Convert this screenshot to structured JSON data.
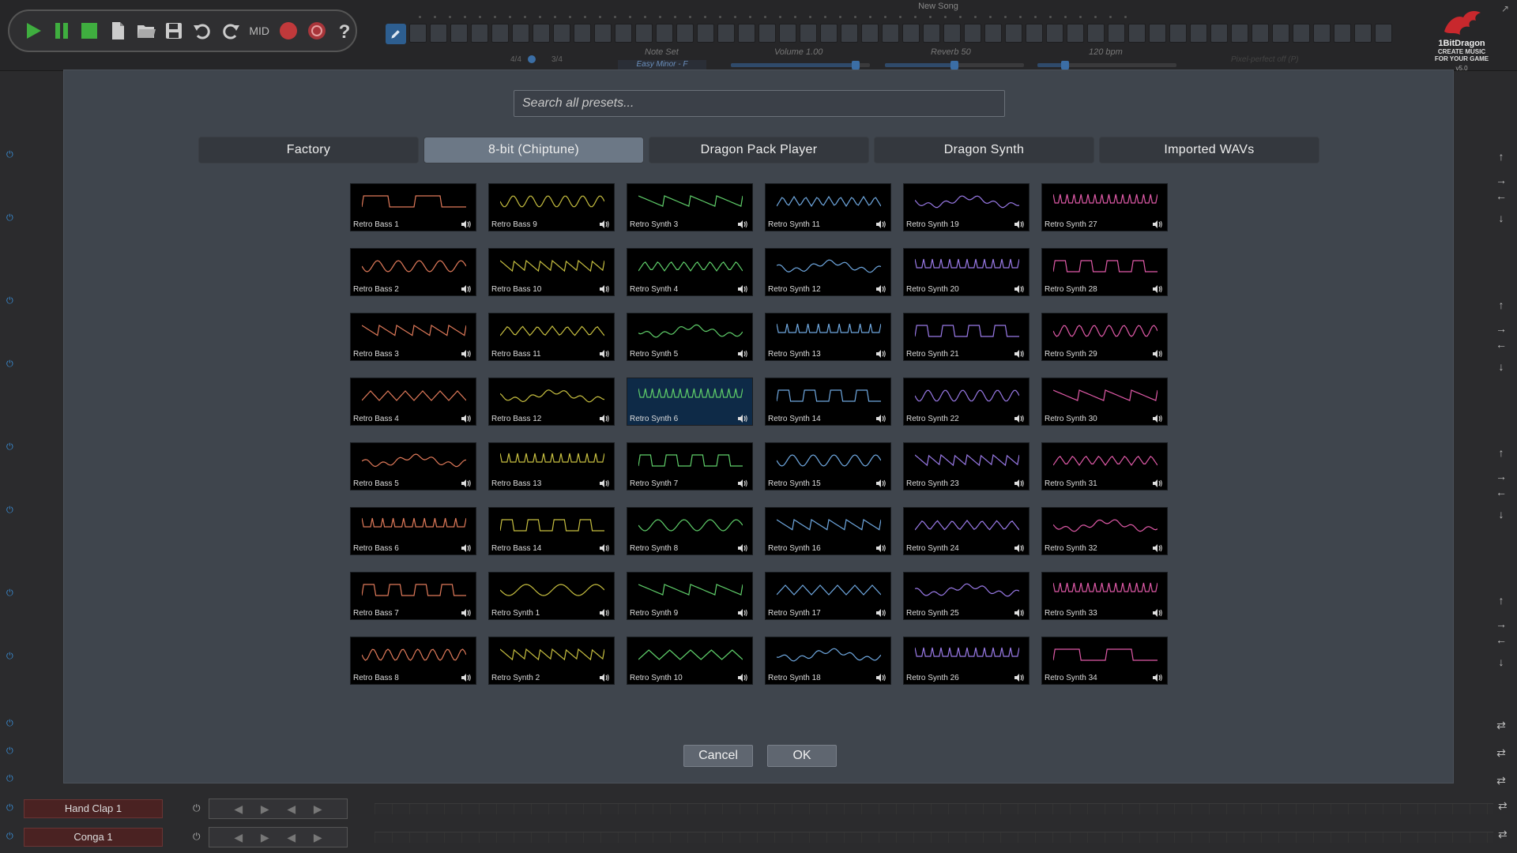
{
  "window": {
    "song_title": "New Song"
  },
  "transport": {
    "mid_label": "MID",
    "icons": [
      "play-icon",
      "pause-icon",
      "stop-icon",
      "new-file-icon",
      "open-folder-icon",
      "save-icon",
      "undo-icon",
      "redo-icon",
      "midi-icon",
      "record-icon",
      "loop-icon",
      "help-icon"
    ]
  },
  "toolbar": {
    "time_sig_1": "4/4",
    "time_sig_2": "3/4",
    "note_set_label": "Note Set",
    "note_set_value": "Easy Minor - F",
    "volume_label": "Volume 1.00",
    "volume_level": 0.9,
    "reverb_label": "Reverb 50",
    "reverb_level": 0.5,
    "tempo_label": "120 bpm",
    "tempo_level": 0.2,
    "pixel_perfect_label": "Pixel-perfect off (P)"
  },
  "logo": {
    "name": "1BitDragon",
    "tagline_1": "CREATE MUSIC",
    "tagline_2": "FOR YOUR GAME",
    "version": "v5.0"
  },
  "bottom_tracks": [
    {
      "name": "Hand Clap 1"
    },
    {
      "name": "Conga 1"
    }
  ],
  "dialog": {
    "search_placeholder": "Search all presets...",
    "tabs": [
      {
        "label": "Factory",
        "active": false
      },
      {
        "label": "8-bit (Chiptune)",
        "active": true
      },
      {
        "label": "Dragon Pack Player",
        "active": false
      },
      {
        "label": "Dragon Synth",
        "active": false
      },
      {
        "label": "Imported WAVs",
        "active": false
      }
    ],
    "columns": [
      {
        "color": "#e07a5a",
        "presets": [
          "Retro Bass 1",
          "Retro Bass 2",
          "Retro Bass 3",
          "Retro Bass 4",
          "Retro Bass 5",
          "Retro Bass 6",
          "Retro Bass 7",
          "Retro Bass 8"
        ]
      },
      {
        "color": "#c8c040",
        "presets": [
          "Retro Bass 9",
          "Retro Bass 10",
          "Retro Bass 11",
          "Retro Bass 12",
          "Retro Bass 13",
          "Retro Bass 14",
          "Retro Synth 1",
          "Retro Synth 2"
        ]
      },
      {
        "color": "#5fcf6a",
        "presets": [
          "Retro Synth 3",
          "Retro Synth 4",
          "Retro Synth 5",
          "Retro Synth 6",
          "Retro Synth 7",
          "Retro Synth 8",
          "Retro Synth 9",
          "Retro Synth 10"
        ]
      },
      {
        "color": "#6fa8e0",
        "presets": [
          "Retro Synth 11",
          "Retro Synth 12",
          "Retro Synth 13",
          "Retro Synth 14",
          "Retro Synth 15",
          "Retro Synth 16",
          "Retro Synth 17",
          "Retro Synth 18"
        ]
      },
      {
        "color": "#9a7ae8",
        "presets": [
          "Retro Synth 19",
          "Retro Synth 20",
          "Retro Synth 21",
          "Retro Synth 22",
          "Retro Synth 23",
          "Retro Synth 24",
          "Retro Synth 25",
          "Retro Synth 26"
        ]
      },
      {
        "color": "#e05aa8",
        "presets": [
          "Retro Synth 27",
          "Retro Synth 28",
          "Retro Synth 29",
          "Retro Synth 30",
          "Retro Synth 31",
          "Retro Synth 32",
          "Retro Synth 33",
          "Retro Synth 34"
        ]
      }
    ],
    "selected_preset": "Retro Synth 6",
    "cancel_label": "Cancel",
    "ok_label": "OK"
  },
  "colors": {
    "accent": "#3b6ea5",
    "tab_active": "#6c7886",
    "selected_cell": "#0e2a47",
    "modal_bg": "#3f454d"
  }
}
